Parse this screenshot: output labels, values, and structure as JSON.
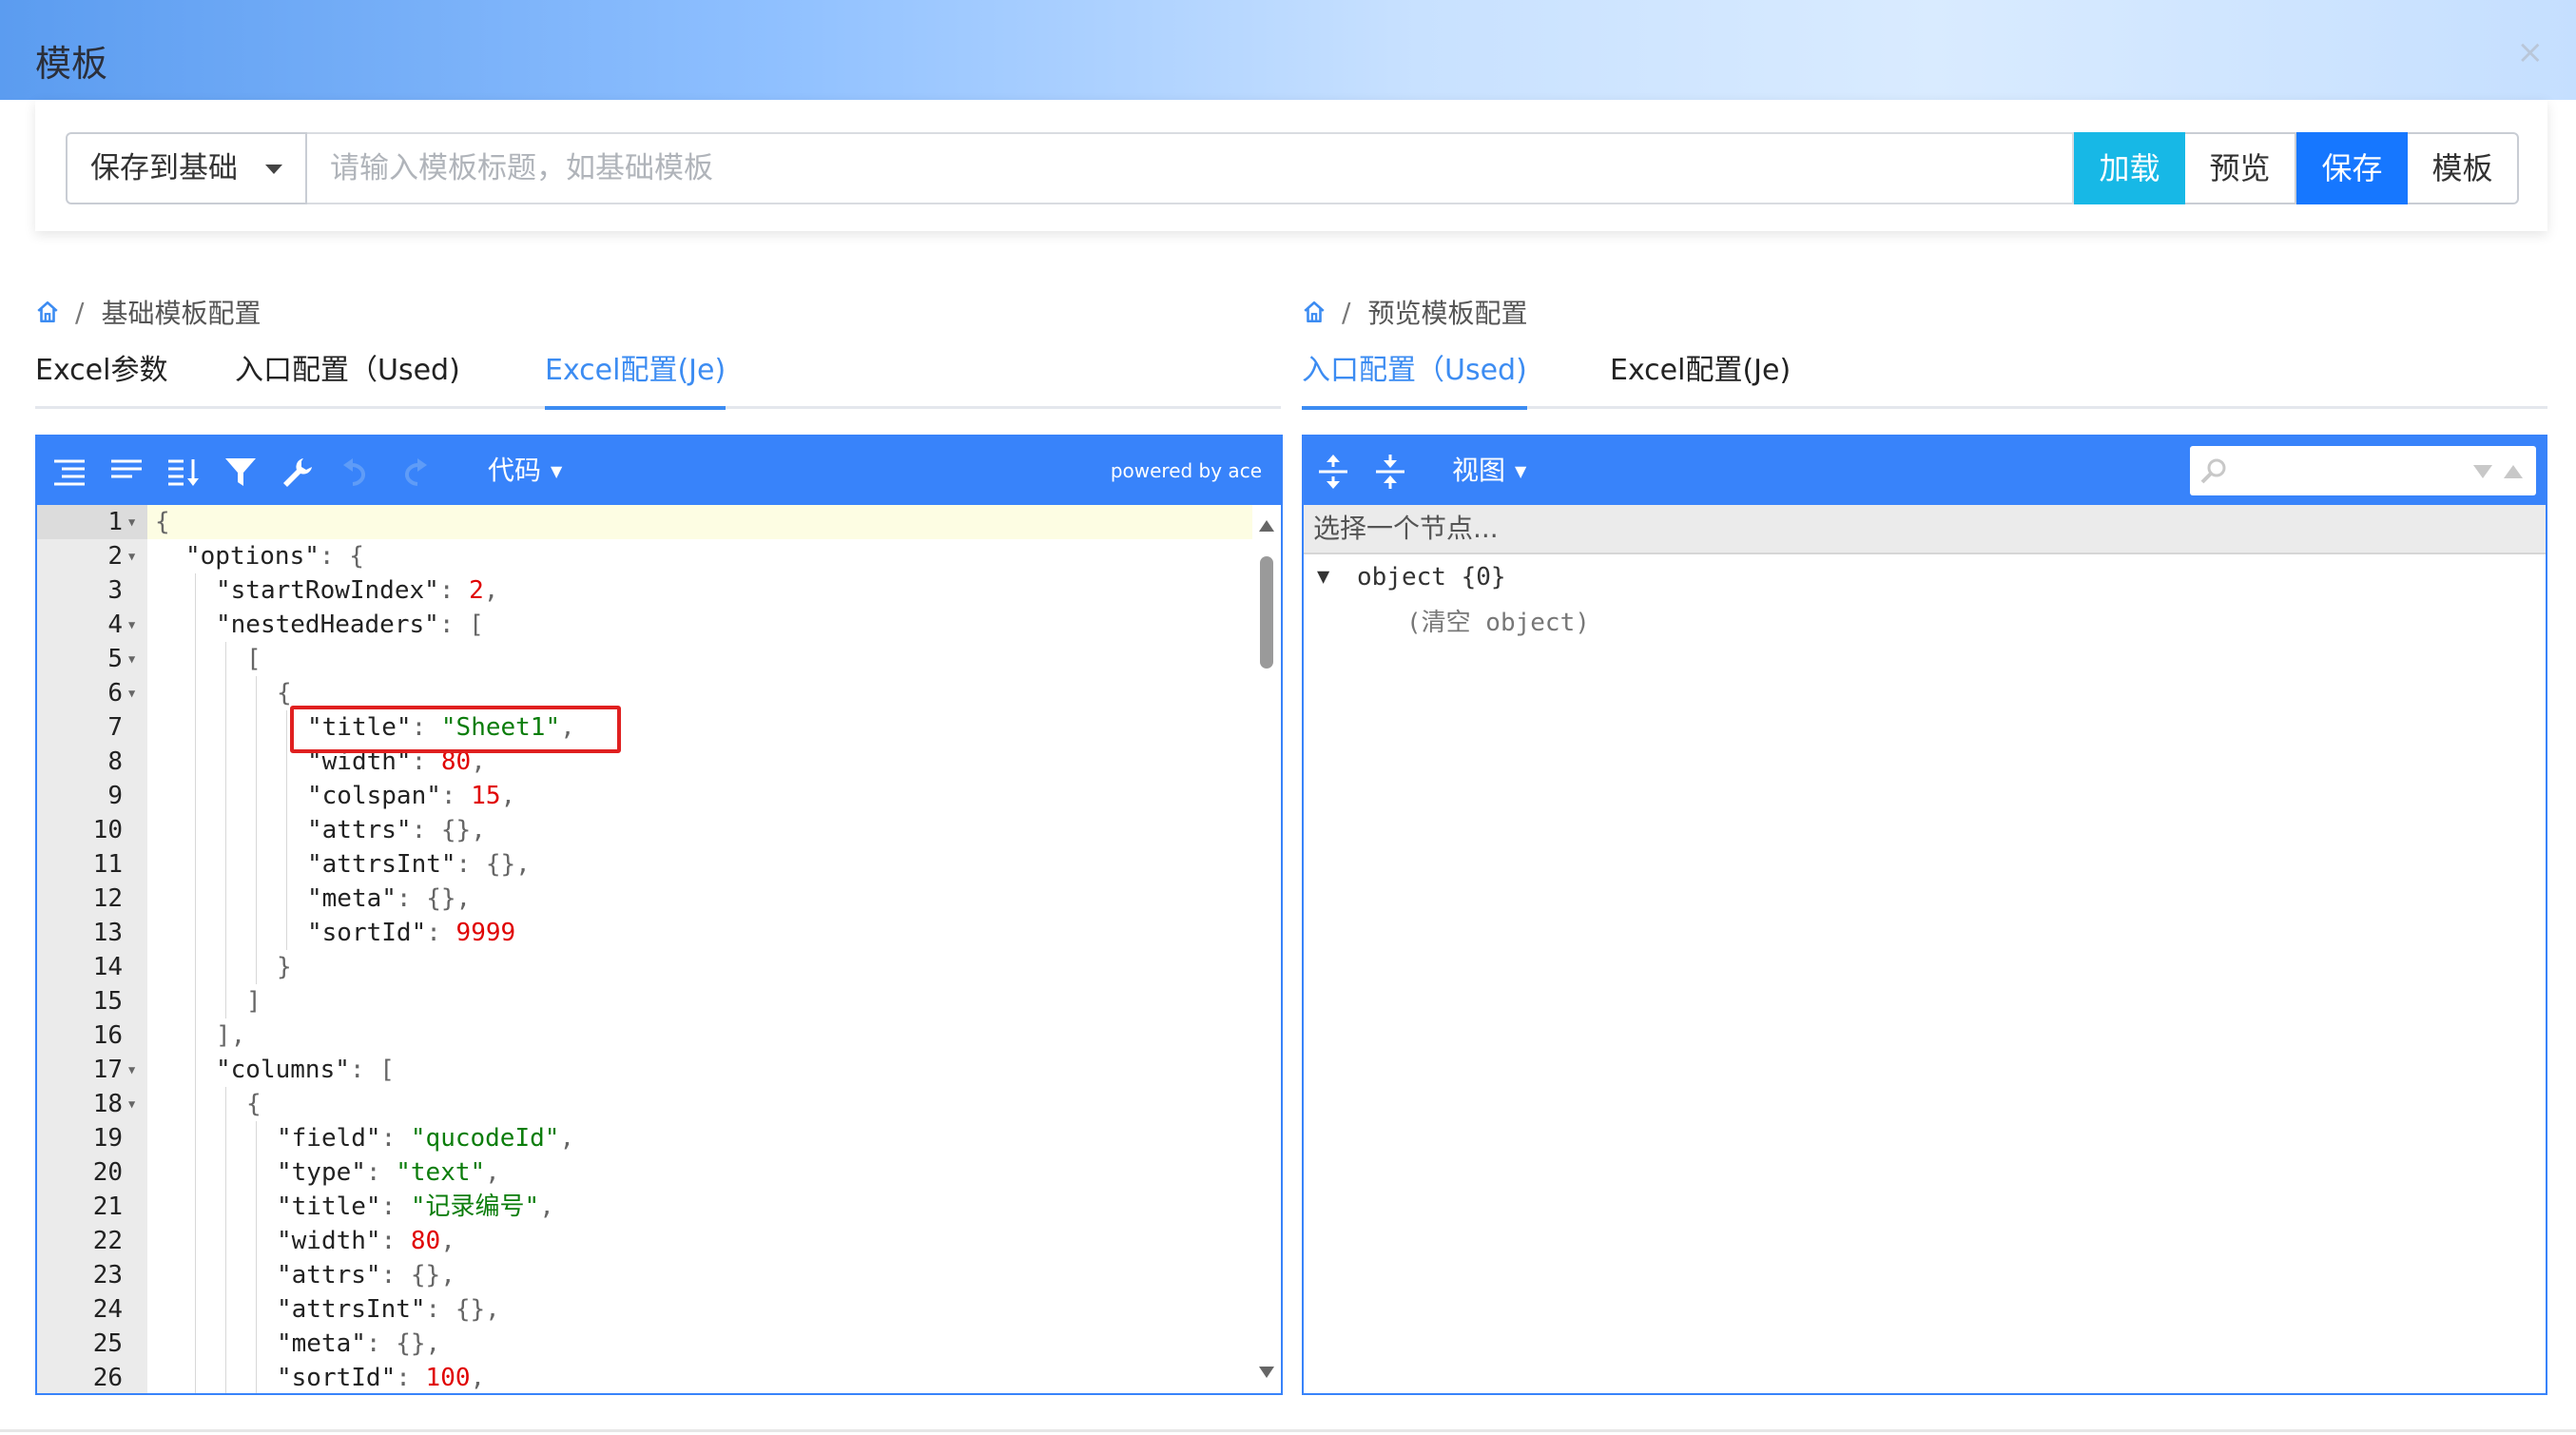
{
  "window": {
    "title": "模板",
    "close_glyph": "×"
  },
  "toolbar": {
    "select_value": "保存到基础",
    "title_placeholder": "请输入模板标题，如基础模板",
    "load_label": "加载",
    "preview_label": "预览",
    "save_label": "保存",
    "template_label": "模板"
  },
  "left": {
    "breadcrumb": "基础模板配置",
    "tabs": [
      "Excel参数",
      "入口配置（Used)",
      "Excel配置(Je)"
    ],
    "active_tab": 2,
    "editor": {
      "mode_label": "代码",
      "powered_by": "powered by ace",
      "lines": [
        {
          "n": "1",
          "fold": true,
          "indent": 0,
          "parts": [
            [
              "p",
              "{"
            ]
          ]
        },
        {
          "n": "2",
          "fold": true,
          "indent": 1,
          "parts": [
            [
              "k",
              "\"options\""
            ],
            [
              "p",
              ": {"
            ]
          ]
        },
        {
          "n": "3",
          "fold": false,
          "indent": 2,
          "parts": [
            [
              "k",
              "\"startRowIndex\""
            ],
            [
              "p",
              ": "
            ],
            [
              "n",
              "2"
            ],
            [
              "p",
              ","
            ]
          ]
        },
        {
          "n": "4",
          "fold": true,
          "indent": 2,
          "parts": [
            [
              "k",
              "\"nestedHeaders\""
            ],
            [
              "p",
              ": ["
            ]
          ]
        },
        {
          "n": "5",
          "fold": true,
          "indent": 3,
          "parts": [
            [
              "p",
              "["
            ]
          ]
        },
        {
          "n": "6",
          "fold": true,
          "indent": 4,
          "parts": [
            [
              "p",
              "{"
            ]
          ]
        },
        {
          "n": "7",
          "fold": false,
          "indent": 5,
          "parts": [
            [
              "k",
              "\"title\""
            ],
            [
              "p",
              ": "
            ],
            [
              "s",
              "\"Sheet1\""
            ],
            [
              "p",
              ","
            ]
          ]
        },
        {
          "n": "8",
          "fold": false,
          "indent": 5,
          "parts": [
            [
              "k",
              "\"width\""
            ],
            [
              "p",
              ": "
            ],
            [
              "n",
              "80"
            ],
            [
              "p",
              ","
            ]
          ]
        },
        {
          "n": "9",
          "fold": false,
          "indent": 5,
          "parts": [
            [
              "k",
              "\"colspan\""
            ],
            [
              "p",
              ": "
            ],
            [
              "n",
              "15"
            ],
            [
              "p",
              ","
            ]
          ]
        },
        {
          "n": "10",
          "fold": false,
          "indent": 5,
          "parts": [
            [
              "k",
              "\"attrs\""
            ],
            [
              "p",
              ": {},"
            ]
          ]
        },
        {
          "n": "11",
          "fold": false,
          "indent": 5,
          "parts": [
            [
              "k",
              "\"attrsInt\""
            ],
            [
              "p",
              ": {},"
            ]
          ]
        },
        {
          "n": "12",
          "fold": false,
          "indent": 5,
          "parts": [
            [
              "k",
              "\"meta\""
            ],
            [
              "p",
              ": {},"
            ]
          ]
        },
        {
          "n": "13",
          "fold": false,
          "indent": 5,
          "parts": [
            [
              "k",
              "\"sortId\""
            ],
            [
              "p",
              ": "
            ],
            [
              "n",
              "9999"
            ]
          ]
        },
        {
          "n": "14",
          "fold": false,
          "indent": 4,
          "parts": [
            [
              "p",
              "}"
            ]
          ]
        },
        {
          "n": "15",
          "fold": false,
          "indent": 3,
          "parts": [
            [
              "p",
              "]"
            ]
          ]
        },
        {
          "n": "16",
          "fold": false,
          "indent": 2,
          "parts": [
            [
              "p",
              "],"
            ]
          ]
        },
        {
          "n": "17",
          "fold": true,
          "indent": 2,
          "parts": [
            [
              "k",
              "\"columns\""
            ],
            [
              "p",
              ": ["
            ]
          ]
        },
        {
          "n": "18",
          "fold": true,
          "indent": 3,
          "parts": [
            [
              "p",
              "{"
            ]
          ]
        },
        {
          "n": "19",
          "fold": false,
          "indent": 4,
          "parts": [
            [
              "k",
              "\"field\""
            ],
            [
              "p",
              ": "
            ],
            [
              "s",
              "\"qucodeId\""
            ],
            [
              "p",
              ","
            ]
          ]
        },
        {
          "n": "20",
          "fold": false,
          "indent": 4,
          "parts": [
            [
              "k",
              "\"type\""
            ],
            [
              "p",
              ": "
            ],
            [
              "s",
              "\"text\""
            ],
            [
              "p",
              ","
            ]
          ]
        },
        {
          "n": "21",
          "fold": false,
          "indent": 4,
          "parts": [
            [
              "k",
              "\"title\""
            ],
            [
              "p",
              ": "
            ],
            [
              "s",
              "\"记录编号\""
            ],
            [
              "p",
              ","
            ]
          ]
        },
        {
          "n": "22",
          "fold": false,
          "indent": 4,
          "parts": [
            [
              "k",
              "\"width\""
            ],
            [
              "p",
              ": "
            ],
            [
              "n",
              "80"
            ],
            [
              "p",
              ","
            ]
          ]
        },
        {
          "n": "23",
          "fold": false,
          "indent": 4,
          "parts": [
            [
              "k",
              "\"attrs\""
            ],
            [
              "p",
              ": {},"
            ]
          ]
        },
        {
          "n": "24",
          "fold": false,
          "indent": 4,
          "parts": [
            [
              "k",
              "\"attrsInt\""
            ],
            [
              "p",
              ": {},"
            ]
          ]
        },
        {
          "n": "25",
          "fold": false,
          "indent": 4,
          "parts": [
            [
              "k",
              "\"meta\""
            ],
            [
              "p",
              ": {},"
            ]
          ]
        },
        {
          "n": "26",
          "fold": false,
          "indent": 4,
          "parts": [
            [
              "k",
              "\"sortId\""
            ],
            [
              "p",
              ": "
            ],
            [
              "n",
              "100"
            ],
            [
              "p",
              ","
            ]
          ]
        }
      ]
    }
  },
  "right": {
    "breadcrumb": "预览模板配置",
    "tabs": [
      "入口配置（Used)",
      "Excel配置(Je)"
    ],
    "active_tab": 0,
    "viewer": {
      "mode_label": "视图",
      "nav_placeholder": "选择一个节点...",
      "root_label": "object {0}",
      "empty_label": "(清空 object)"
    }
  },
  "colors": {
    "accent": "#3883fa",
    "load": "#17b8e6",
    "save": "#1677ff",
    "highlight": "#e02020"
  }
}
